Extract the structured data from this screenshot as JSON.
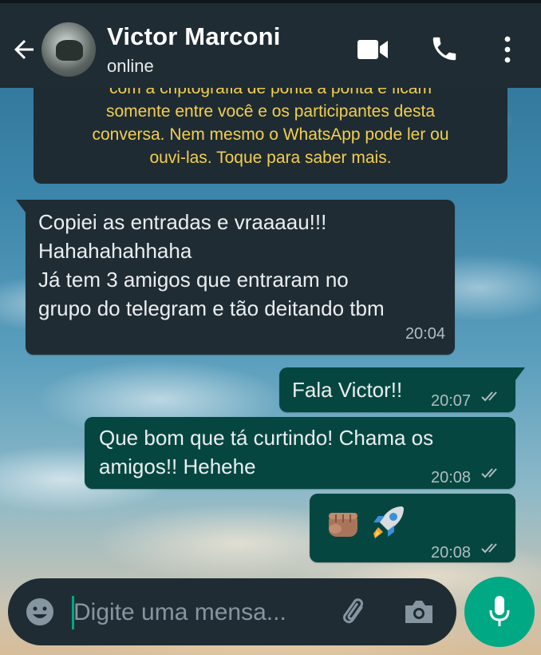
{
  "header": {
    "contact_name": "Victor Marconi",
    "status": "online",
    "icons": [
      "back-arrow-icon",
      "video-call-icon",
      "phone-icon",
      "more-vert-icon"
    ]
  },
  "encryption_notice": {
    "lines": [
      "com a criptografia de ponta a ponta e ficam",
      "somente entre você e os participantes desta",
      "conversa. Nem mesmo o WhatsApp pode ler ou",
      "ouvi-las. Toque para saber mais."
    ]
  },
  "messages": [
    {
      "direction": "incoming",
      "lines": [
        "Copiei as entradas e vraaaau!!!",
        "Hahahahahhaha",
        "Já tem 3 amigos que entraram no",
        "grupo do telegram e tão deitando tbm"
      ],
      "time": "20:04"
    },
    {
      "direction": "outgoing",
      "text": "Fala Victor!!",
      "time": "20:07",
      "status": "read"
    },
    {
      "direction": "outgoing",
      "lines": [
        "Que bom que tá curtindo! Chama os",
        "amigos!! Hehehe"
      ],
      "time": "20:08",
      "status": "read"
    },
    {
      "direction": "outgoing",
      "emojis": [
        "fist-emoji",
        "rocket-emoji"
      ],
      "time": "20:08",
      "status": "read"
    }
  ],
  "input": {
    "placeholder": "Digite uma mensa..."
  },
  "colors": {
    "header_bg": "#1f2c34",
    "incoming_bubble": "#1f2c34",
    "outgoing_bubble": "#054740",
    "accent": "#00a884",
    "notice_text": "#f4cf4e"
  }
}
